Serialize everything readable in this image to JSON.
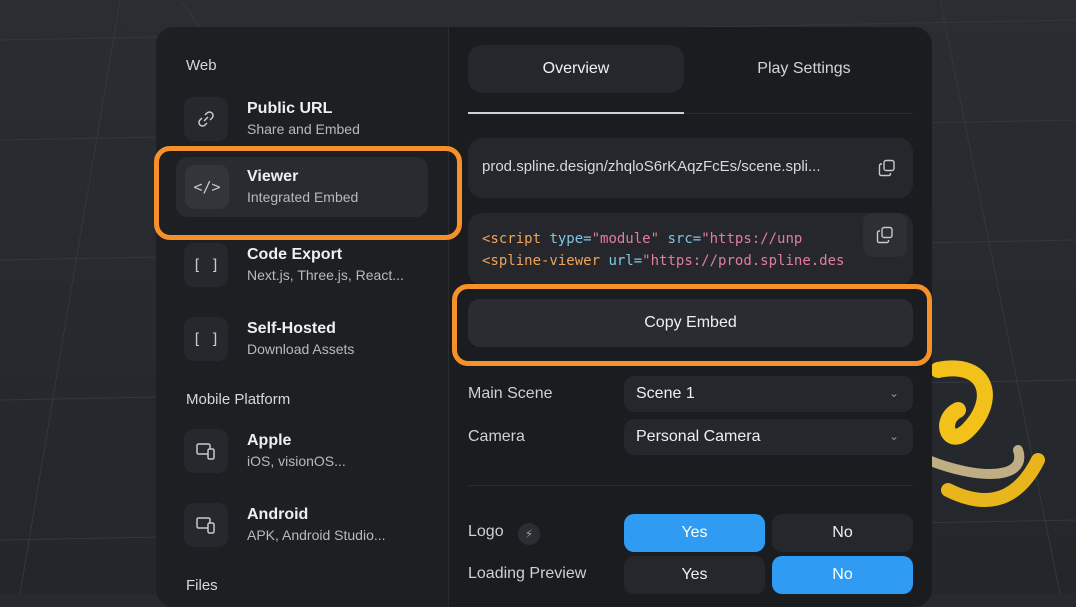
{
  "sidebar": {
    "sections": {
      "web": "Web",
      "mobile": "Mobile Platform",
      "files": "Files"
    },
    "items": [
      {
        "title": "Public URL",
        "subtitle": "Share and Embed",
        "icon": "link-icon"
      },
      {
        "title": "Viewer",
        "subtitle": "Integrated Embed",
        "icon": "code-icon",
        "active": true
      },
      {
        "title": "Code Export",
        "subtitle": "Next.js, Three.js, React...",
        "icon": "brackets-icon"
      },
      {
        "title": "Self-Hosted",
        "subtitle": "Download Assets",
        "icon": "brackets-icon"
      },
      {
        "title": "Apple",
        "subtitle": "iOS, visionOS...",
        "icon": "devices-icon"
      },
      {
        "title": "Android",
        "subtitle": "APK, Android Studio...",
        "icon": "devices-icon"
      }
    ]
  },
  "tabs": [
    "Overview",
    "Play Settings"
  ],
  "embed": {
    "url": "prod.spline.design/zhqloS6rKAqzFcEs/scene.spli...",
    "code_line1_tag": "<script",
    "code_line1_attr1": " type=",
    "code_line1_val1": "\"module\"",
    "code_line1_attr2": " src=",
    "code_line1_val2": "\"https://unp",
    "code_line2_tag": "<spline-viewer",
    "code_line2_attr": " url=",
    "code_line2_val": "\"https://prod.spline.des",
    "copy_button": "Copy Embed"
  },
  "settings": {
    "main_scene_label": "Main Scene",
    "main_scene_value": "Scene 1",
    "camera_label": "Camera",
    "camera_value": "Personal Camera",
    "logo_label": "Logo",
    "loading_label": "Loading Preview",
    "yes": "Yes",
    "no": "No",
    "logo_selected": "Yes",
    "loading_selected": "No"
  },
  "colors": {
    "accent": "#2f9bf3",
    "highlight": "#f5902a"
  }
}
